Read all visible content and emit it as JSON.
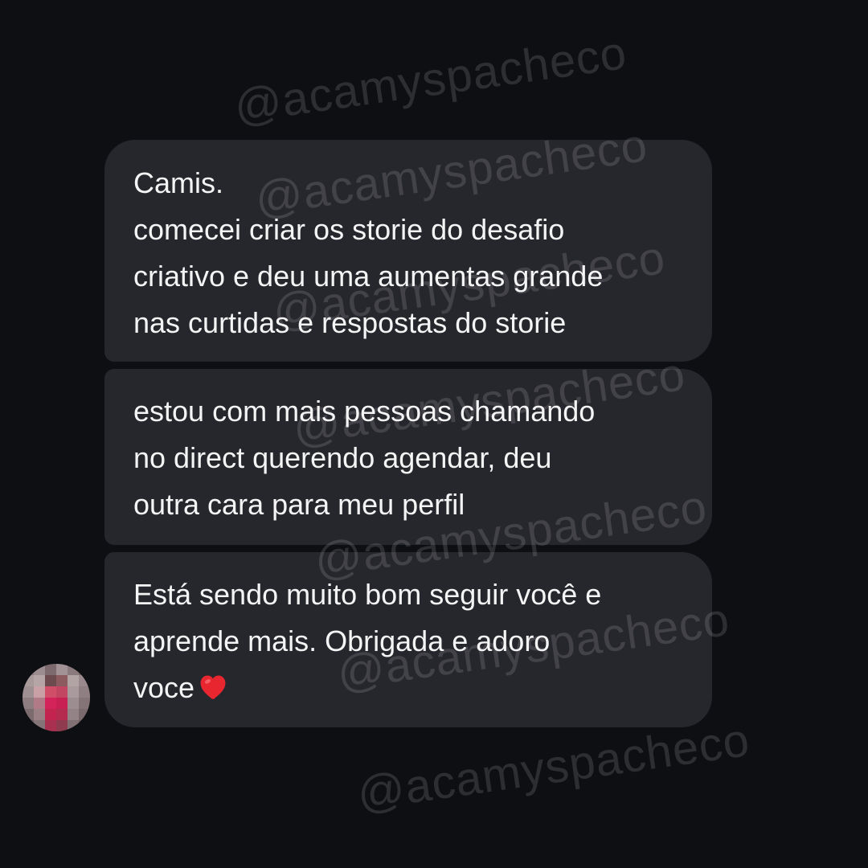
{
  "watermark": "@acamyspacheco",
  "messages": [
    {
      "lines": [
        "Camis.",
        "comecei criar os storie do desafio",
        "criativo e deu uma aumentas grande",
        "nas curtidas e respostas do storie"
      ]
    },
    {
      "lines": [
        "estou com mais pessoas chamando",
        "no direct querendo agendar, deu",
        "outra cara para meu perfil"
      ]
    },
    {
      "lines": [
        "Está sendo muito bom seguir você e",
        "aprende mais. Obrigada e adoro",
        "voce"
      ],
      "trailing_emoji": "red-heart-icon"
    }
  ],
  "colors": {
    "background": "#0e0f13",
    "bubble": "#26272d",
    "text": "#f4f4f5",
    "heart": "#e8262f",
    "watermark": "rgba(255,255,255,0.13)"
  },
  "avatar": {
    "state": "pixelated"
  }
}
